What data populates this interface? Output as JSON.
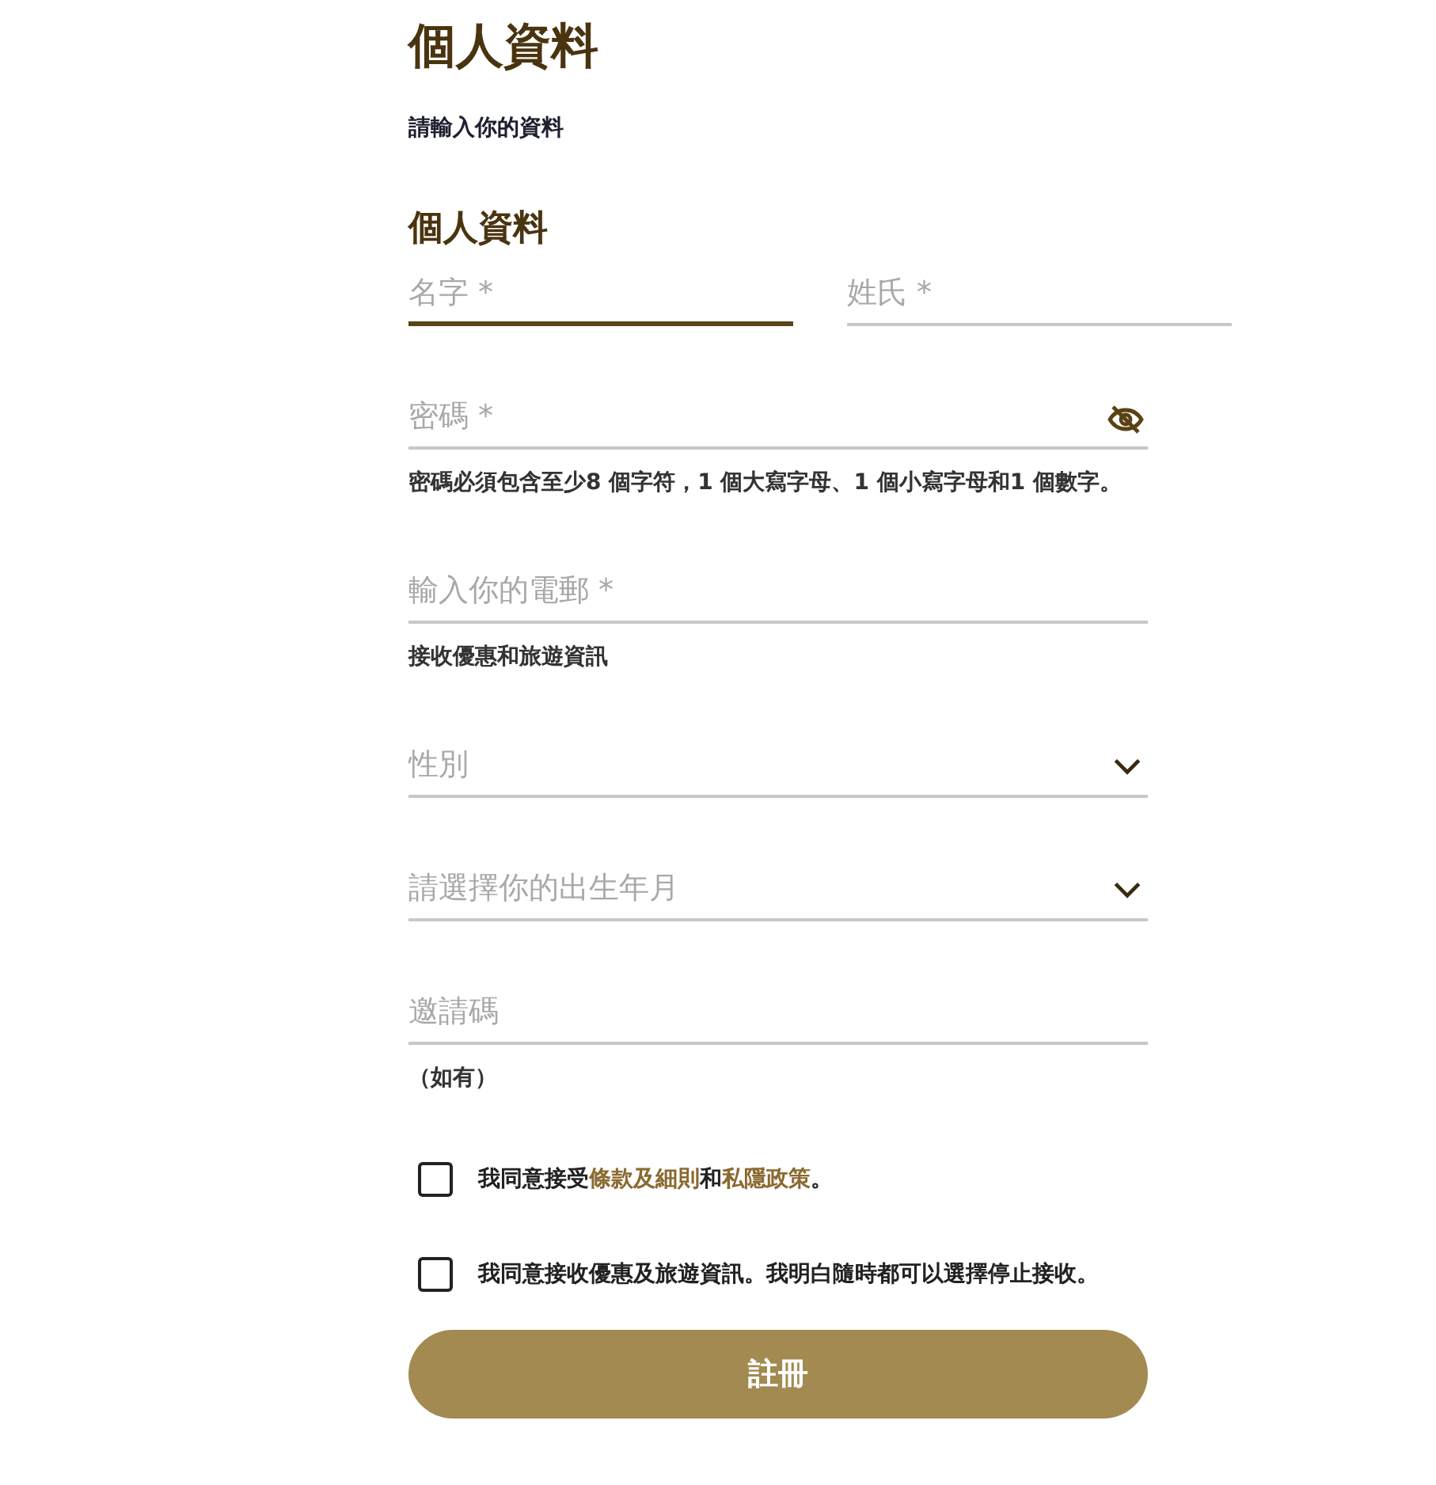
{
  "title": "個人資料",
  "subtitle": "請輸入你的資料",
  "section_title": "個人資料",
  "name_fields": [
    {
      "placeholder": "名字 *",
      "focused": true
    },
    {
      "placeholder": "姓氏 *",
      "focused": false
    }
  ],
  "fields": [
    {
      "kind": "password",
      "placeholder": "密碼 *",
      "focused": false,
      "hint": "密碼必須包含至少8 個字符，1 個大寫字母、1 個小寫字母和1 個數字。"
    },
    {
      "kind": "text",
      "placeholder": "輸入你的電郵 *",
      "focused": false,
      "hint": "接收優惠和旅遊資訊"
    },
    {
      "kind": "select",
      "placeholder": "性別",
      "focused": false
    },
    {
      "kind": "select",
      "placeholder": "請選擇你的出生年月",
      "focused": false
    },
    {
      "kind": "text",
      "placeholder": "邀請碼",
      "focused": false,
      "hint": "（如有）"
    }
  ],
  "agreements": [
    {
      "checked": false,
      "parts": [
        {
          "kind": "plain",
          "text": "我同意接受"
        },
        {
          "kind": "link",
          "text": "條款及細則"
        },
        {
          "kind": "plain",
          "text": "和"
        },
        {
          "kind": "link",
          "text": "私隱政策"
        },
        {
          "kind": "plain",
          "text": "。"
        }
      ]
    },
    {
      "checked": false,
      "parts": [
        {
          "kind": "plain",
          "text": "我同意接收優惠及旅遊資訊。我明白隨時都可以選擇停止接收。"
        }
      ]
    }
  ],
  "submit_button": "註冊"
}
